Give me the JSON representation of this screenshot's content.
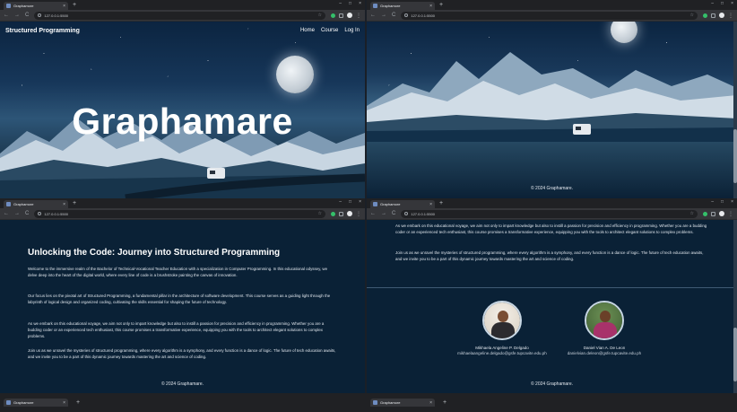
{
  "browser": {
    "tab_title": "Graphamore",
    "tab_close": "×",
    "new_tab": "+",
    "back": "←",
    "forward": "→",
    "reload": "C",
    "bookmark": "☆",
    "menu": "⋮",
    "window_controls": [
      "–",
      "□",
      "×"
    ],
    "urls": [
      "127.0.0.1:5500",
      "127.0.0.1:5500",
      "127.0.0.1:5500",
      "127.0.0.1:5500"
    ]
  },
  "site": {
    "brand": "Structured Programming",
    "nav": [
      "Home",
      "Course",
      "Log In"
    ],
    "hero_title": "Graphamare",
    "footer": "© 2024 Graphamare."
  },
  "about": {
    "heading": "Unlocking the Code: Journey into Structured Programming",
    "paragraphs": [
      "Welcome to the immersive realm of the Bachelor of Technical-Vocational Teacher Education with a specialization in Computer Programming. In this educational odyssey, we delve deep into the heart of the digital world, where every line of code is a brushstroke painting the canvas of innovation.",
      "Our focus lies on the pivotal art of Structured Programming, a fundamental pillar in the architecture of software development. This course serves as a guiding light through the labyrinth of logical design and organized coding, cultivating the skills essential for shaping the future of technology.",
      "As we embark on this educational voyage, we aim not only to impart knowledge but also to instill a passion for precision and efficiency in programming. Whether you are a budding coder or an experienced tech enthusiast, this course promises a transformative experience, equipping you with the tools to architect elegant solutions to complex problems.",
      "Join us as we unravel the mysteries of structured programming, where every algorithm is a symphony, and every function is a dance of logic. The future of tech education awaits, and we invite you to be a part of this dynamic journey towards mastering the art and science of coding."
    ]
  },
  "team": [
    {
      "name": "Mikhaela Angeline P. Delgado",
      "email": "mikhaelaangeline.delgado@gsfe.tupcavite.edu.ph"
    },
    {
      "name": "Daniel Vian A. De Leon",
      "email": "danielvian.deleon@gsfe.tupcavite.edu.ph"
    }
  ],
  "icons": {
    "moon": "moon-image",
    "camper": "camper-van-image"
  },
  "colors": {
    "page_bg": "#0a2136",
    "browser_frame": "#202124",
    "toolbar": "#35363a"
  }
}
